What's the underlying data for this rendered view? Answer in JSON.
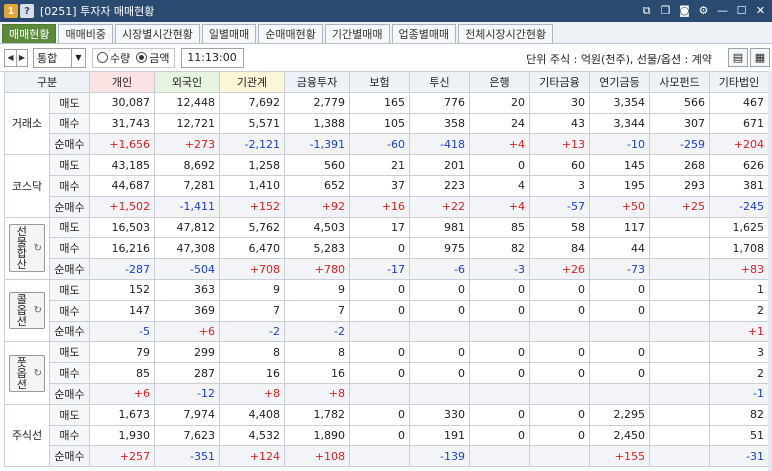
{
  "window": {
    "badge_num": "1",
    "badge_help": "?",
    "title": "[0251] 투자자 매매현황"
  },
  "tabs": [
    "매매현황",
    "매매비중",
    "시장별시간현황",
    "일별매매",
    "순매매현황",
    "기간별매매",
    "업종별매매",
    "전체시장시간현황"
  ],
  "toolbar": {
    "select_value": "통합",
    "radio_qty": "수량",
    "radio_amt": "금액",
    "time": "11:13:00",
    "unit": "단위 주식 : 억원(천주), 선물/옵션 : 계약"
  },
  "headers": [
    "구분",
    "개인",
    "외국인",
    "기관계",
    "금융투자",
    "보험",
    "투신",
    "은행",
    "기타금융",
    "연기금등",
    "사모펀드",
    "기타법인"
  ],
  "row_labels": [
    "매도",
    "매수",
    "순매수"
  ],
  "markets": [
    {
      "name": "거래소",
      "button": false,
      "rows": [
        [
          "30,087",
          "12,448",
          "7,692",
          "2,779",
          "165",
          "776",
          "20",
          "30",
          "3,354",
          "566",
          "467"
        ],
        [
          "31,743",
          "12,721",
          "5,571",
          "1,388",
          "105",
          "358",
          "24",
          "43",
          "3,344",
          "307",
          "671"
        ],
        [
          "+1,656",
          "+273",
          "-2,121",
          "-1,391",
          "-60",
          "-418",
          "+4",
          "+13",
          "-10",
          "-259",
          "+204"
        ]
      ]
    },
    {
      "name": "코스닥",
      "button": false,
      "rows": [
        [
          "43,185",
          "8,692",
          "1,258",
          "560",
          "21",
          "201",
          "0",
          "60",
          "145",
          "268",
          "626"
        ],
        [
          "44,687",
          "7,281",
          "1,410",
          "652",
          "37",
          "223",
          "4",
          "3",
          "195",
          "293",
          "381"
        ],
        [
          "+1,502",
          "-1,411",
          "+152",
          "+92",
          "+16",
          "+22",
          "+4",
          "-57",
          "+50",
          "+25",
          "-245"
        ]
      ]
    },
    {
      "name": "선물합산",
      "button": true,
      "btn_line1": "선물",
      "btn_line2": "합산",
      "rows": [
        [
          "16,503",
          "47,812",
          "5,762",
          "4,503",
          "17",
          "981",
          "85",
          "58",
          "117",
          "",
          "1,625"
        ],
        [
          "16,216",
          "47,308",
          "6,470",
          "5,283",
          "0",
          "975",
          "82",
          "84",
          "44",
          "",
          "1,708"
        ],
        [
          "-287",
          "-504",
          "+708",
          "+780",
          "-17",
          "-6",
          "-3",
          "+26",
          "-73",
          "",
          "+83"
        ]
      ]
    },
    {
      "name": "콜옵션",
      "button": true,
      "btn_line1": "콜",
      "btn_line2": "옵션",
      "rows": [
        [
          "152",
          "363",
          "9",
          "9",
          "0",
          "0",
          "0",
          "0",
          "0",
          "",
          "1"
        ],
        [
          "147",
          "369",
          "7",
          "7",
          "0",
          "0",
          "0",
          "0",
          "0",
          "",
          "2"
        ],
        [
          "-5",
          "+6",
          "-2",
          "-2",
          "",
          "",
          "",
          "",
          "",
          "",
          "+1"
        ]
      ]
    },
    {
      "name": "풋옵션",
      "button": true,
      "btn_line1": "풋",
      "btn_line2": "옵션",
      "rows": [
        [
          "79",
          "299",
          "8",
          "8",
          "0",
          "0",
          "0",
          "0",
          "0",
          "",
          "3"
        ],
        [
          "85",
          "287",
          "16",
          "16",
          "0",
          "0",
          "0",
          "0",
          "0",
          "",
          "2"
        ],
        [
          "+6",
          "-12",
          "+8",
          "+8",
          "",
          "",
          "",
          "",
          "",
          "",
          "-1"
        ]
      ]
    },
    {
      "name": "주식선",
      "button": false,
      "rows": [
        [
          "1,673",
          "7,974",
          "4,408",
          "1,782",
          "0",
          "330",
          "0",
          "0",
          "2,295",
          "",
          "82"
        ],
        [
          "1,930",
          "7,623",
          "4,532",
          "1,890",
          "0",
          "191",
          "0",
          "0",
          "2,450",
          "",
          "51"
        ],
        [
          "+257",
          "-351",
          "+124",
          "+108",
          "",
          "-139",
          "",
          "",
          "+155",
          "",
          "-31"
        ]
      ]
    }
  ]
}
